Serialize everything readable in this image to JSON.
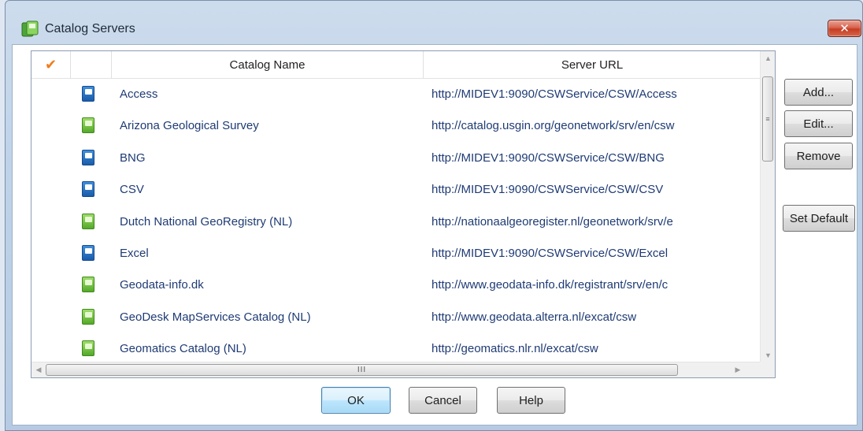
{
  "window": {
    "title": "Catalog Servers",
    "close_label": "✕"
  },
  "table": {
    "columns": {
      "check": "✔",
      "name": "Catalog Name",
      "url": "Server URL"
    },
    "rows": [
      {
        "name": "Access",
        "url": "http://MIDEV1:9090/CSWService/CSW/Access",
        "icon": "blue-catalog-icon"
      },
      {
        "name": "Arizona Geological Survey",
        "url": "http://catalog.usgin.org/geonetwork/srv/en/csw",
        "icon": "green-catalog-icon"
      },
      {
        "name": "BNG",
        "url": "http://MIDEV1:9090/CSWService/CSW/BNG",
        "icon": "blue-catalog-icon"
      },
      {
        "name": "CSV",
        "url": "http://MIDEV1:9090/CSWService/CSW/CSV",
        "icon": "blue-catalog-icon"
      },
      {
        "name": "Dutch National GeoRegistry (NL)",
        "url": "http://nationaalgeoregister.nl/geonetwork/srv/e",
        "icon": "green-catalog-icon"
      },
      {
        "name": "Excel",
        "url": "http://MIDEV1:9090/CSWService/CSW/Excel",
        "icon": "blue-catalog-icon"
      },
      {
        "name": "Geodata-info.dk",
        "url": "http://www.geodata-info.dk/registrant/srv/en/c",
        "icon": "green-catalog-icon"
      },
      {
        "name": "GeoDesk MapServices Catalog (NL)",
        "url": "http://www.geodata.alterra.nl/excat/csw",
        "icon": "green-catalog-icon"
      },
      {
        "name": "Geomatics Catalog (NL)",
        "url": "http://geomatics.nlr.nl/excat/csw",
        "icon": "green-catalog-icon"
      }
    ],
    "hscroll_grip": "III",
    "vscroll_grip": "≡"
  },
  "side_buttons": {
    "add": "Add...",
    "edit": "Edit...",
    "remove": "Remove",
    "set_default": "Set Default"
  },
  "footer_buttons": {
    "ok": "OK",
    "cancel": "Cancel",
    "help": "Help"
  },
  "colors": {
    "accent_check": "#f07d1e",
    "link_text": "#1f3b74",
    "blue_icon": "#1a5cab",
    "green_icon": "#55a92a"
  }
}
